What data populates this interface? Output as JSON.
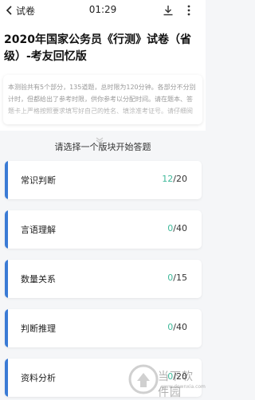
{
  "topbar": {
    "back_label": "试卷",
    "time": "01:29",
    "download_icon": "download-icon",
    "more_icon": "more-vertical-icon"
  },
  "exam": {
    "title": "2020年国家公务员《行测》试卷（省级）-考友回忆版",
    "description": "本测验共有5个部分，135道题，总时限为120分钟。各部分不分别计时，但都给出了参考时限，供你参考以分配时间。请在题本、答题卡上严格按照要求填写好自己的姓名、填涂准考证号。请仔细阅读以下注意事项：...",
    "expand_icon": "chevron-down-icon"
  },
  "section_prompt": "请选择一个版块开始答题",
  "sections": [
    {
      "name": "常识判断",
      "done": "12",
      "total": "/20"
    },
    {
      "name": "言语理解",
      "done": "0",
      "total": "/40"
    },
    {
      "name": "数量关系",
      "done": "0",
      "total": "/15"
    },
    {
      "name": "判断推理",
      "done": "0",
      "total": "/40"
    },
    {
      "name": "资料分析",
      "done": "0",
      "total": "/20"
    }
  ],
  "watermark": {
    "brand": "当下软件园",
    "url": "www.downxia.com"
  },
  "colors": {
    "accent": "#3a7bd5",
    "progress_done": "#3fb99a"
  }
}
